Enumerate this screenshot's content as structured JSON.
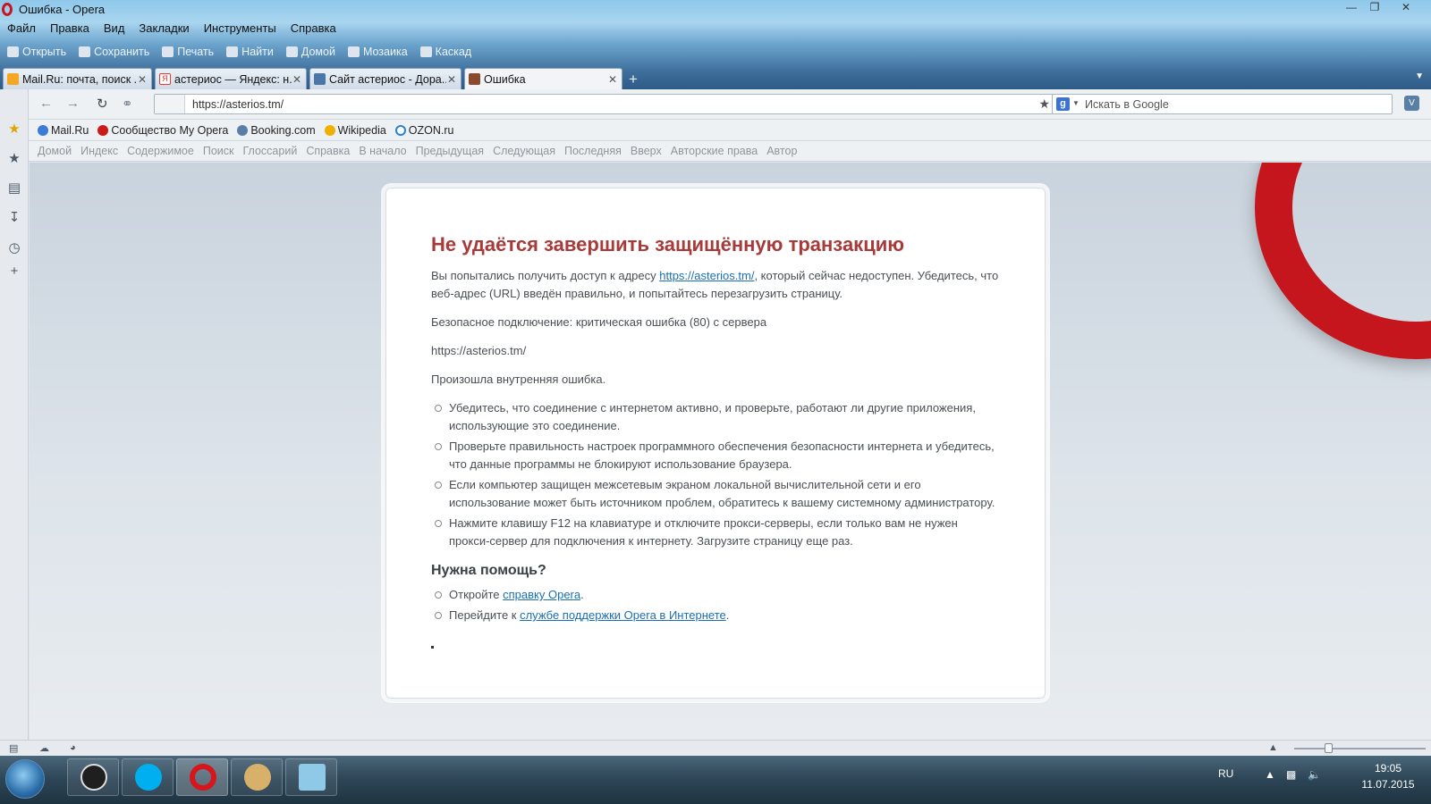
{
  "window": {
    "title": "Ошибка - Opera"
  },
  "menu": [
    "Файл",
    "Правка",
    "Вид",
    "Закладки",
    "Инструменты",
    "Справка"
  ],
  "toolbar": [
    "Открыть",
    "Сохранить",
    "Печать",
    "Найти",
    "Домой",
    "Мозаика",
    "Каскад"
  ],
  "tabs": [
    {
      "label": "Mail.Ru: почта, поиск ...",
      "icon": "mailru-icon",
      "color": "#f5a623"
    },
    {
      "label": "астериос — Яндекс: н...",
      "icon": "yandex-icon",
      "color": "#e03c31"
    },
    {
      "label": "Сайт астериос - Дора...",
      "icon": "vk-icon",
      "color": "#4a76a8"
    },
    {
      "label": "Ошибка",
      "icon": "error-page-icon",
      "color": "#8b4a2b"
    }
  ],
  "address": {
    "url": "https://asterios.tm/"
  },
  "search": {
    "placeholder": "Искать в Google"
  },
  "bookmarks": [
    {
      "label": "Mail.Ru",
      "color": "#3b7bd6"
    },
    {
      "label": "Сообщество My Opera",
      "color": "#cc1a1a"
    },
    {
      "label": "Booking.com",
      "color": "#5b7ea8"
    },
    {
      "label": "Wikipedia",
      "color": "#f0b000"
    },
    {
      "label": "OZON.ru",
      "color": "#2a7fd6"
    }
  ],
  "navlinks": [
    "Домой",
    "Индекс",
    "Содержимое",
    "Поиск",
    "Глоссарий",
    "Справка",
    "В начало",
    "Предыдущая",
    "Следующая",
    "Последняя",
    "Вверх",
    "Авторские права",
    "Автор"
  ],
  "error": {
    "title": "Не удаётся завершить защищённую транзакцию",
    "intro_before": "Вы попытались получить доступ к адресу ",
    "intro_link": "https://asterios.tm/",
    "intro_after": ", который сейчас недоступен. Убедитесь, что веб-адрес (URL) введён правильно, и попытайтесь перезагрузить страницу.",
    "detail": "Безопасное подключение: критическая ошибка (80) с сервера",
    "server": "https://asterios.tm/",
    "internal": "Произошла внутренняя ошибка.",
    "tips": [
      "Убедитесь, что соединение с интернетом активно, и проверьте, работают ли другие приложения, использующие это соединение.",
      "Проверьте правильность настроек программного обеспечения безопасности интернета и убедитесь, что данные программы не блокируют использование браузера.",
      "Если компьютер защищен межсетевым экраном локальной вычислительной сети и его использование может быть источником проблем, обратитесь к вашему системному администратору.",
      "Нажмите клавишу F12 на клавиатуре и отключите прокси-серверы, если только вам не нужен прокси-сервер для подключения к интернету. Загрузите страницу еще раз."
    ],
    "help_title": "Нужна помощь?",
    "help1_before": "Откройте ",
    "help1_link": "справку Opera",
    "help1_after": ".",
    "help2_before": "Перейдите к ",
    "help2_link": "службе поддержки Opera в Интернете",
    "help2_after": "."
  },
  "tray": {
    "lang": "RU",
    "time": "19:05",
    "date": "11.07.2015"
  },
  "colors": {
    "error_title": "#a83a3a",
    "link": "#1a6fb3",
    "opera_red": "#c4161c"
  }
}
